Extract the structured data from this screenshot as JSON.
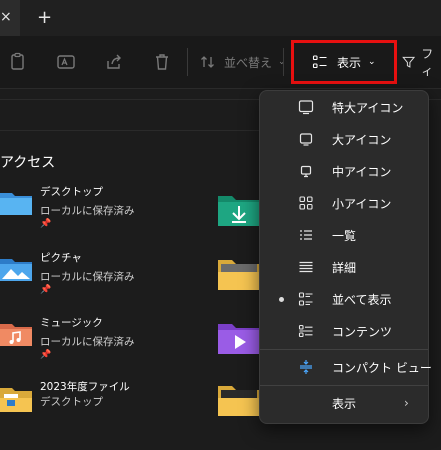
{
  "titlebar": {
    "close_glyph": "×",
    "newtab_glyph": "+"
  },
  "toolbar": {
    "sort_label": "並べ替え",
    "view_label": "表示",
    "filter_label": "フィ"
  },
  "section_title": "アクセス",
  "items": [
    {
      "name": "デスクトップ",
      "sub": "ローカルに保存済み",
      "pin": "📌"
    },
    {
      "name": "ピクチャ",
      "sub": "ローカルに保存済み",
      "pin": "📌"
    },
    {
      "name": "ミュージック",
      "sub": "ローカルに保存済み",
      "pin": "📌"
    },
    {
      "name": "2023年度ファイル",
      "sub": "デスクトップ",
      "pin": ""
    }
  ],
  "menu": {
    "items": [
      {
        "label": "特大アイコン",
        "icon": "monitor-large-icon"
      },
      {
        "label": "大アイコン",
        "icon": "monitor-icon"
      },
      {
        "label": "中アイコン",
        "icon": "monitor-small-icon"
      },
      {
        "label": "小アイコン",
        "icon": "grid-icon"
      },
      {
        "label": "一覧",
        "icon": "list-icon"
      },
      {
        "label": "詳細",
        "icon": "details-icon"
      },
      {
        "label": "並べて表示",
        "icon": "tiles-icon",
        "selected": true
      },
      {
        "label": "コンテンツ",
        "icon": "content-icon"
      },
      {
        "label": "コンパクト ビュー",
        "icon": "compact-view-icon"
      },
      {
        "label": "表示",
        "icon": "",
        "submenu": true
      }
    ]
  },
  "colors": {
    "highlight_border": "#e81010",
    "menu_bg": "#2b2b2b",
    "accent_blue": "#4aa8ff"
  }
}
